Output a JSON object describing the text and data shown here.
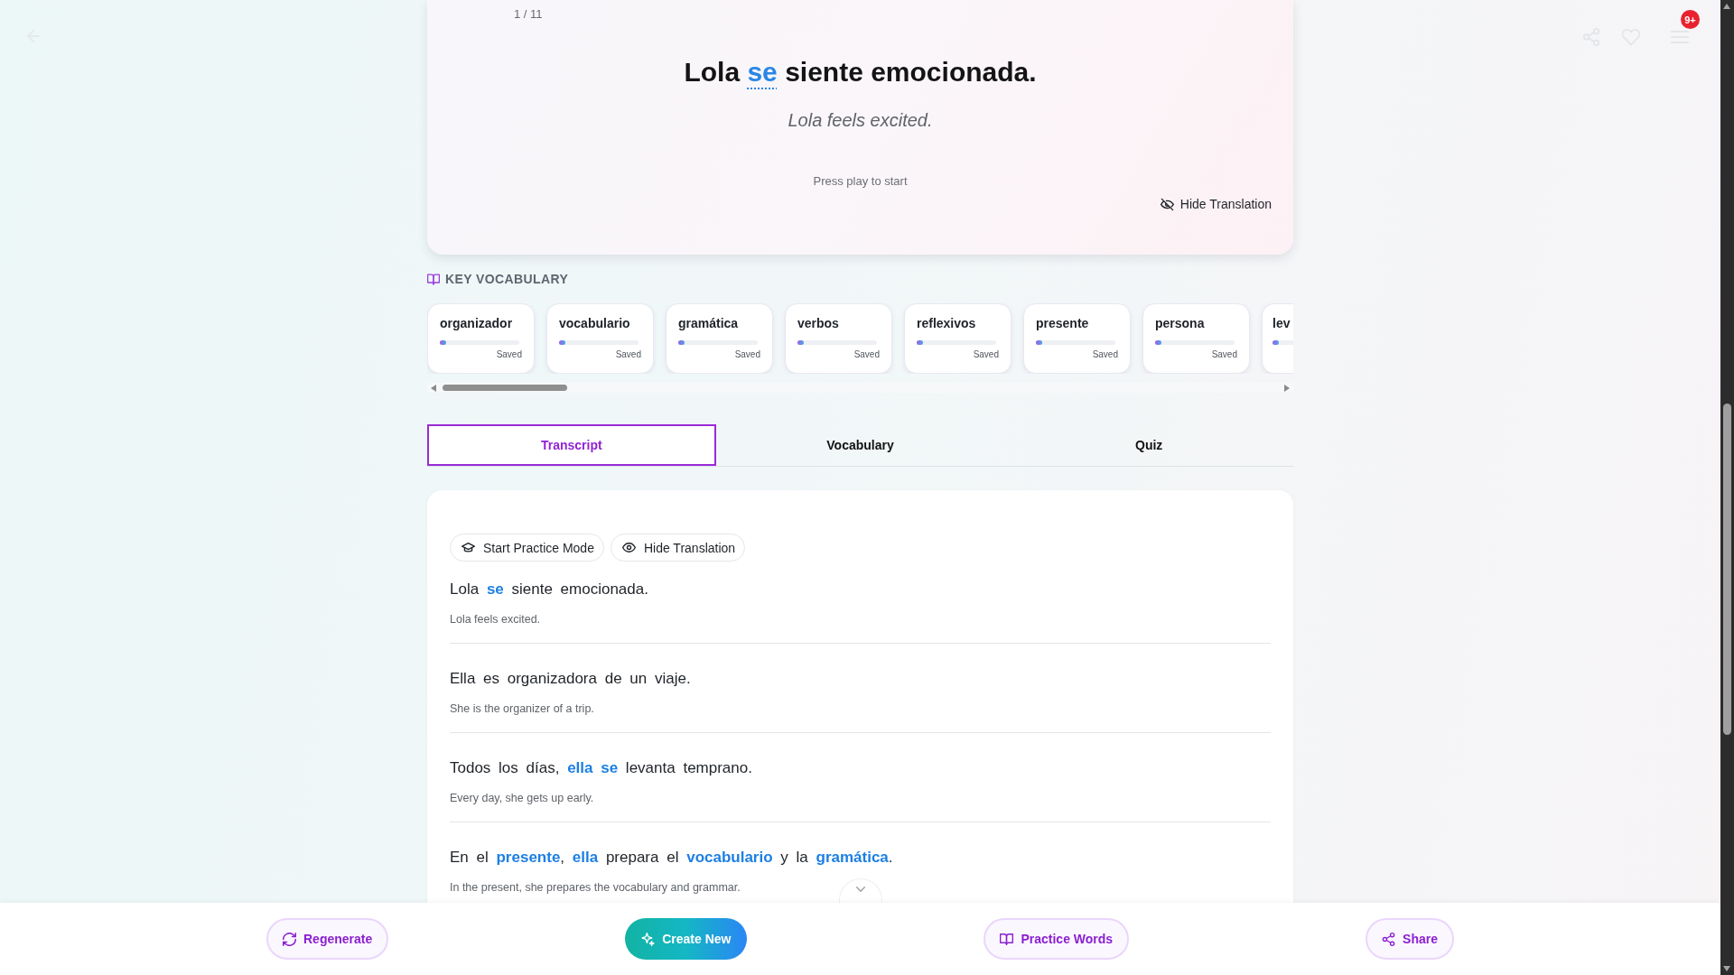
{
  "header": {
    "notification_count": "9+"
  },
  "player": {
    "counter": "1 / 11",
    "sentence": "Lola **se** siente emocionada.",
    "translation": "Lola feels excited.",
    "status": "Press play to start",
    "translation_toggle": "Hide Translation"
  },
  "key_vocabulary": {
    "title": "KEY VOCABULARY",
    "cards": [
      {
        "word": "organizador",
        "level": 0.08,
        "status": "Saved"
      },
      {
        "word": "vocabulario",
        "level": 0.08,
        "status": "Saved"
      },
      {
        "word": "gramática",
        "level": 0.08,
        "status": "Saved"
      },
      {
        "word": "verbos",
        "level": 0.08,
        "status": "Saved"
      },
      {
        "word": "reflexivos",
        "level": 0.08,
        "status": "Saved"
      },
      {
        "word": "presente",
        "level": 0.08,
        "status": "Saved"
      },
      {
        "word": "persona",
        "level": 0.08,
        "status": "Saved"
      },
      {
        "word": "lev",
        "level": 0.08
      }
    ]
  },
  "tabs": [
    {
      "label": "Transcript",
      "selected": true
    },
    {
      "label": "Vocabulary",
      "selected": false
    },
    {
      "label": "Quiz",
      "selected": false
    }
  ],
  "transcript": {
    "buttons": [
      "Start Practice Mode",
      "Hide Translation"
    ],
    "lines": [
      {
        "sentence": "Lola **se** siente emocionada.",
        "translation": "Lola feels excited."
      },
      {
        "sentence": "Ella es organizadora de un viaje.",
        "translation": "She is the organizer of a trip."
      },
      {
        "sentence": "Todos los días, **ella** **se** levanta temprano.",
        "translation": "Every day, she gets up early."
      },
      {
        "sentence": "En el **presente**, **ella** prepara el **vocabulario** y la **gramática**.",
        "translation": "In the present, she prepares the vocabulary and grammar."
      }
    ]
  },
  "bottom_bar": {
    "buttons": [
      {
        "label": "Regenerate",
        "kind": "secondary"
      },
      {
        "label": "Create New",
        "kind": "primary"
      },
      {
        "label": "Practice Words",
        "kind": "secondary"
      },
      {
        "label": "Share",
        "kind": "secondary"
      }
    ]
  }
}
